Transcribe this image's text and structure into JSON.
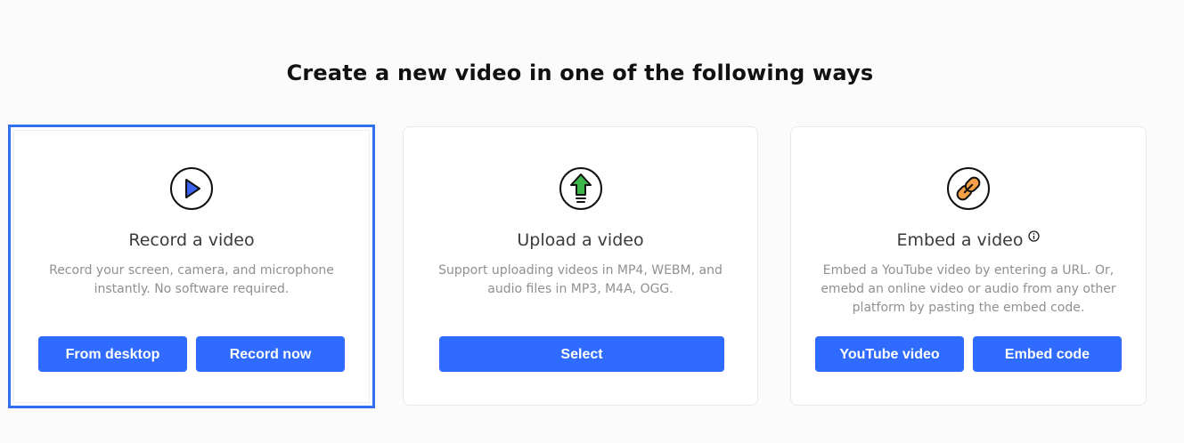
{
  "heading": "Create a new video in one of the following ways",
  "colors": {
    "accent": "#2f6bff",
    "selected_border": "#2f6ff0",
    "play_icon_fill": "#3b63f0",
    "upload_icon_fill": "#3db54a",
    "link_icon_fill": "#f5a046"
  },
  "cards": [
    {
      "title": "Record a video",
      "icon": "play-icon",
      "description": "Record your screen, camera, and microphone instantly. No software required.",
      "buttons": [
        "From desktop",
        "Record now"
      ],
      "selected": true
    },
    {
      "title": "Upload a video",
      "icon": "upload-arrow-icon",
      "description": "Support uploading videos in MP4, WEBM, and audio files in MP3, M4A, OGG.",
      "buttons": [
        "Select"
      ],
      "selected": false
    },
    {
      "title": "Embed a video",
      "icon": "link-icon",
      "info_icon": "info-icon",
      "description": "Embed a YouTube video by entering a URL. Or, emebd an online video or audio from any other platform by pasting the embed code.",
      "buttons": [
        "YouTube video",
        "Embed code"
      ],
      "selected": false
    }
  ]
}
